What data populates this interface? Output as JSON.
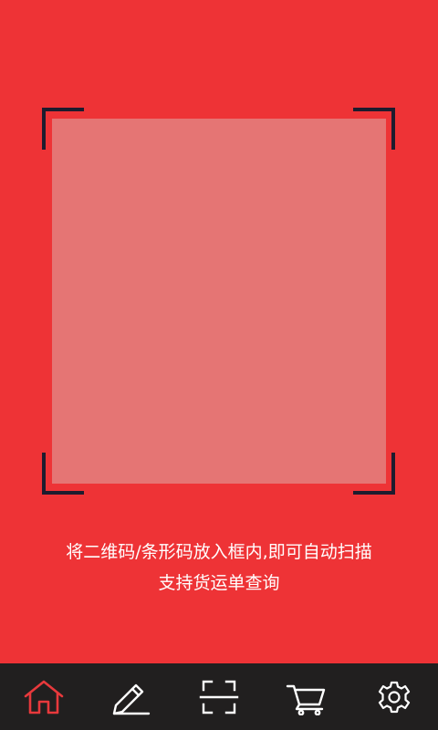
{
  "hint": {
    "line1": "将二维码/条形码放入框内,即可自动扫描",
    "line2": "支持货运单查询"
  },
  "nav": {
    "items": [
      {
        "icon": "home-icon",
        "active": true
      },
      {
        "icon": "pencil-icon",
        "active": false
      },
      {
        "icon": "scan-icon",
        "active": false
      },
      {
        "icon": "cart-icon",
        "active": false
      },
      {
        "icon": "gear-icon",
        "active": false
      }
    ]
  },
  "colors": {
    "background": "#ee3336",
    "scan_window": "#e57574",
    "corner": "#1e1c2e",
    "nav_background": "#211f1f",
    "nav_active": "#e8393c",
    "nav_inactive": "#ffffff"
  }
}
